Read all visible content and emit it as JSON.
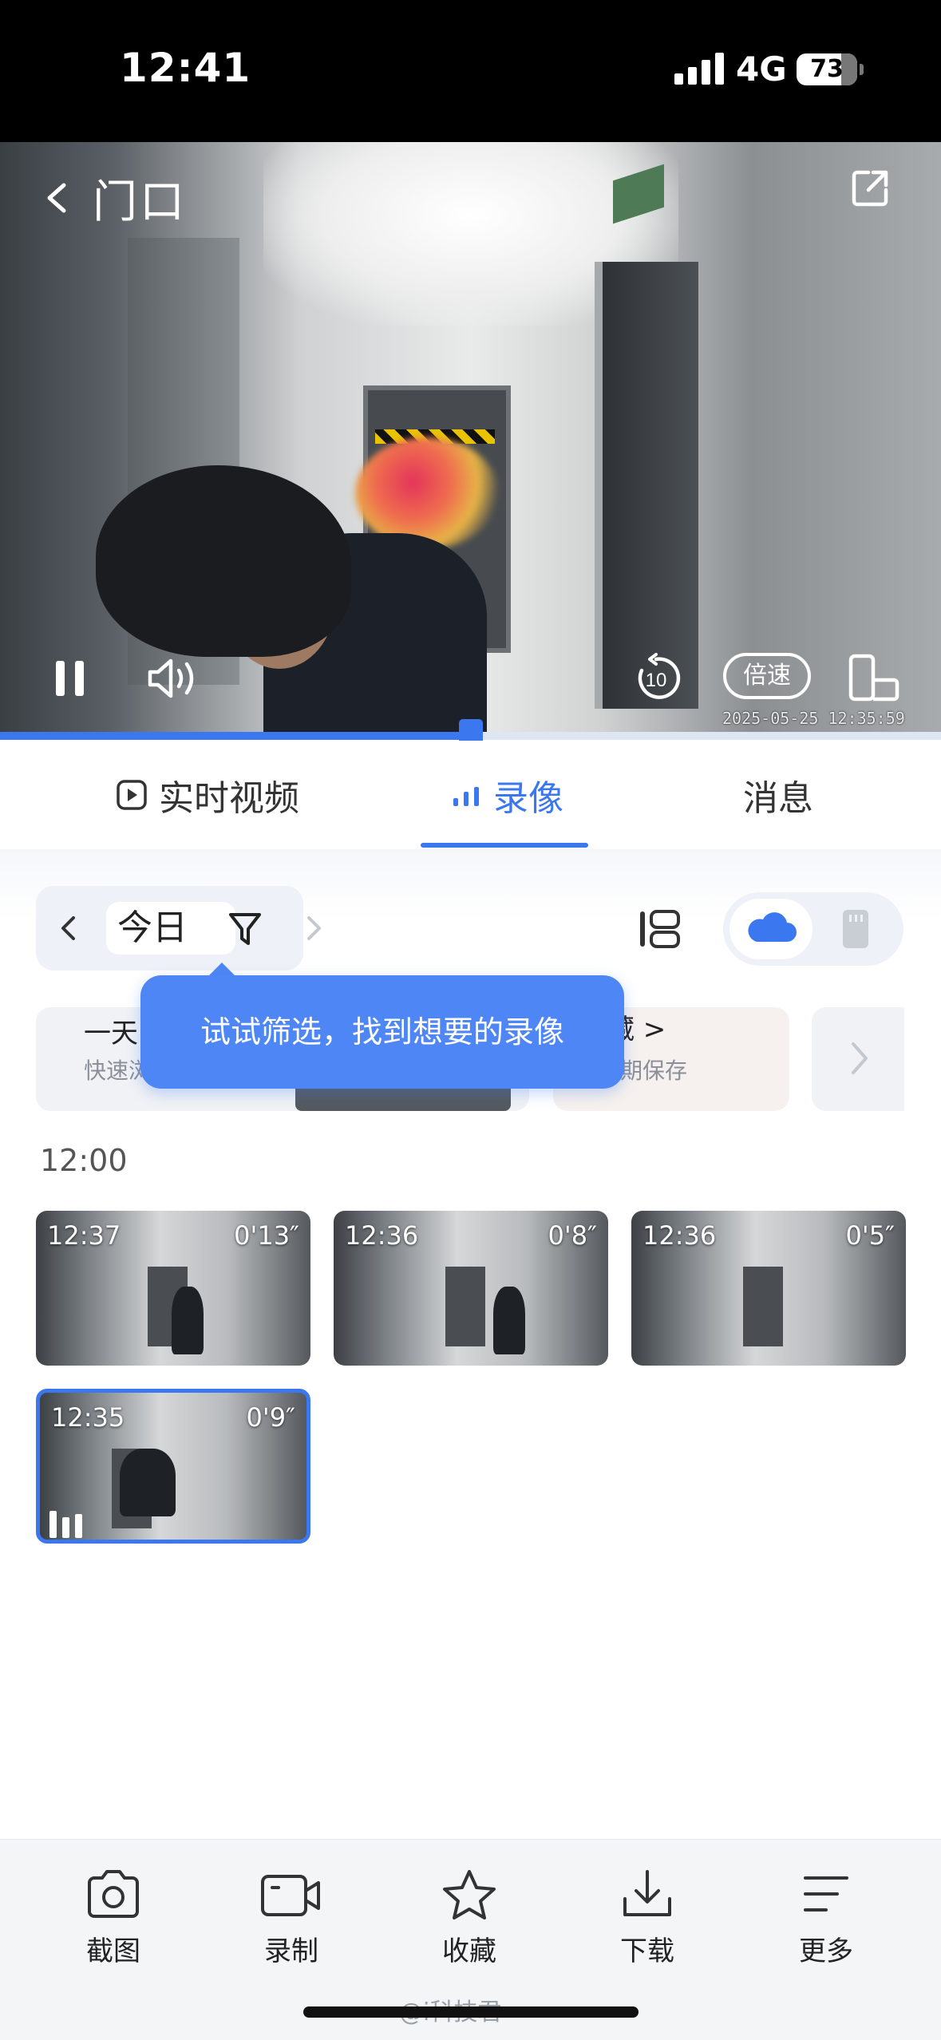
{
  "status_bar": {
    "time": "12:41",
    "network": "4G",
    "battery": "73"
  },
  "player": {
    "title": "门口",
    "speed_label": "倍速",
    "replay_label": "10",
    "timestamp": "2025-05-25 12:35:59",
    "progress": 0.5
  },
  "tabs": [
    {
      "label": "实时视频",
      "active": false
    },
    {
      "label": "录像",
      "active": true
    },
    {
      "label": "消息",
      "active": false
    }
  ],
  "filter": {
    "date_label": "今日"
  },
  "tooltip": "试试筛选，找到想要的录像",
  "cards": [
    {
      "title": "一天",
      "subtitle": "快速浏"
    },
    {
      "title": "的收藏 >",
      "subtitle": "藏可长期保存"
    }
  ],
  "hour_label": "12:00",
  "clips": [
    {
      "time": "12:37",
      "duration": "0'13″",
      "selected": false
    },
    {
      "time": "12:36",
      "duration": "0'8″",
      "selected": false
    },
    {
      "time": "12:36",
      "duration": "0'5″",
      "selected": false
    },
    {
      "time": "12:35",
      "duration": "0'9″",
      "selected": true
    }
  ],
  "toolbar": [
    {
      "label": "截图",
      "icon": "camera-icon"
    },
    {
      "label": "录制",
      "icon": "video-camera-icon"
    },
    {
      "label": "收藏",
      "icon": "star-icon"
    },
    {
      "label": "下载",
      "icon": "download-icon"
    },
    {
      "label": "更多",
      "icon": "more-menu-icon"
    }
  ],
  "watermark": "@i科技君",
  "colors": {
    "accent": "#3b78f0",
    "tooltip": "#4e86f5"
  }
}
